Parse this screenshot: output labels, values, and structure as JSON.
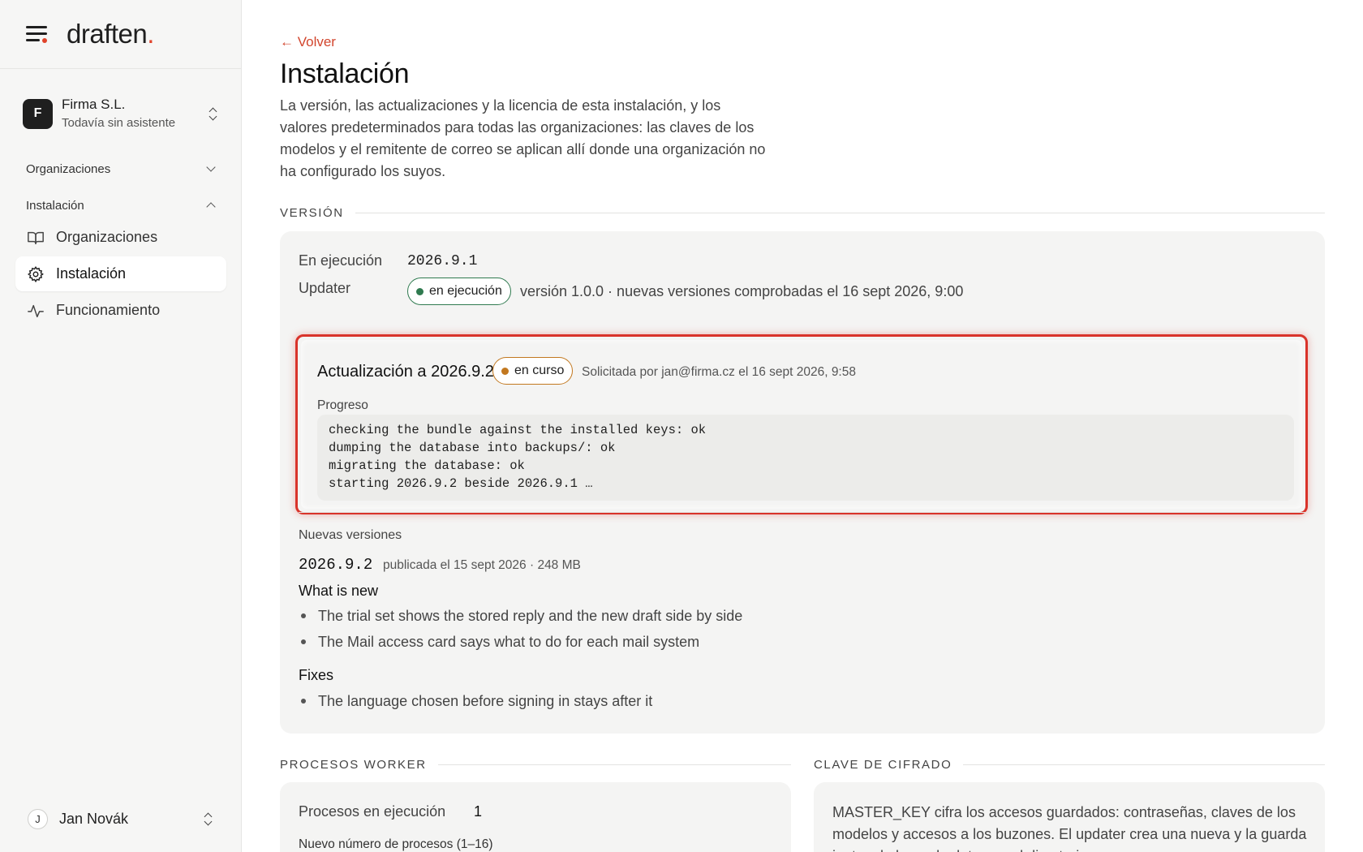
{
  "brand": {
    "name": "draften",
    "dot": "."
  },
  "org": {
    "initial": "F",
    "name": "Firma S.L.",
    "subtitle": "Todavía sin asistente"
  },
  "nav": {
    "sections": [
      {
        "label": "Organizaciones"
      },
      {
        "label": "Instalación"
      }
    ],
    "items": [
      {
        "label": "Organizaciones",
        "icon": "book-icon"
      },
      {
        "label": "Instalación",
        "icon": "gear-icon",
        "active": true
      },
      {
        "label": "Funcionamiento",
        "icon": "activity-icon"
      }
    ]
  },
  "user": {
    "initial": "J",
    "name": "Jan Novák"
  },
  "page": {
    "back": "← Volver",
    "title": "Instalación",
    "intro": "La versión, las actualizaciones y la licencia de esta instalación, y los valores predeterminados para todas las organizaciones: las claves de los modelos y el remitente de correo se aplican allí donde una organización no ha configurado los suyos."
  },
  "version": {
    "heading": "VERSIÓN",
    "running_label": "En ejecución",
    "running_value": "2026.9.1",
    "updater_label": "Updater",
    "updater_status": "en ejecución",
    "updater_info": "versión 1.0.0 · nuevas versiones comprobadas el 16 sept 2026, 9:00",
    "update": {
      "title": "Actualización a 2026.9.2",
      "status": "en curso",
      "meta": "Solicitada por jan@firma.cz el 16 sept 2026, 9:58",
      "progress_label": "Progreso",
      "log": [
        "checking the bundle against the installed keys: ok",
        "dumping the database into backups/: ok",
        "migrating the database: ok",
        "starting 2026.9.2 beside 2026.9.1 …"
      ]
    },
    "new_versions": {
      "label": "Nuevas versiones",
      "version": "2026.9.2",
      "published": "publicada el 15 sept 2026 · 248 MB",
      "whats_new_title": "What is new",
      "whats_new": [
        "The trial set shows the stored reply and the new draft side by side",
        "The Mail access card says what to do for each mail system"
      ],
      "fixes_title": "Fixes",
      "fixes": [
        "The language chosen before signing in stays after it"
      ]
    }
  },
  "workers": {
    "heading": "PROCESOS WORKER",
    "running_label": "Procesos en ejecución",
    "running_value": "1",
    "new_label": "Nuevo número de procesos (1–16)"
  },
  "encryption": {
    "heading": "CLAVE DE CIFRADO",
    "text": "MASTER_KEY cifra los accesos guardados: contraseñas, claves de los modelos y accesos a los buzones. El updater crea una nueva y la guarda junto a la base de datos en el directorio."
  },
  "colors": {
    "accent": "#e0432a",
    "ok": "#2f7a4f",
    "pending": "#c2781f",
    "highlight": "#d9332a"
  }
}
